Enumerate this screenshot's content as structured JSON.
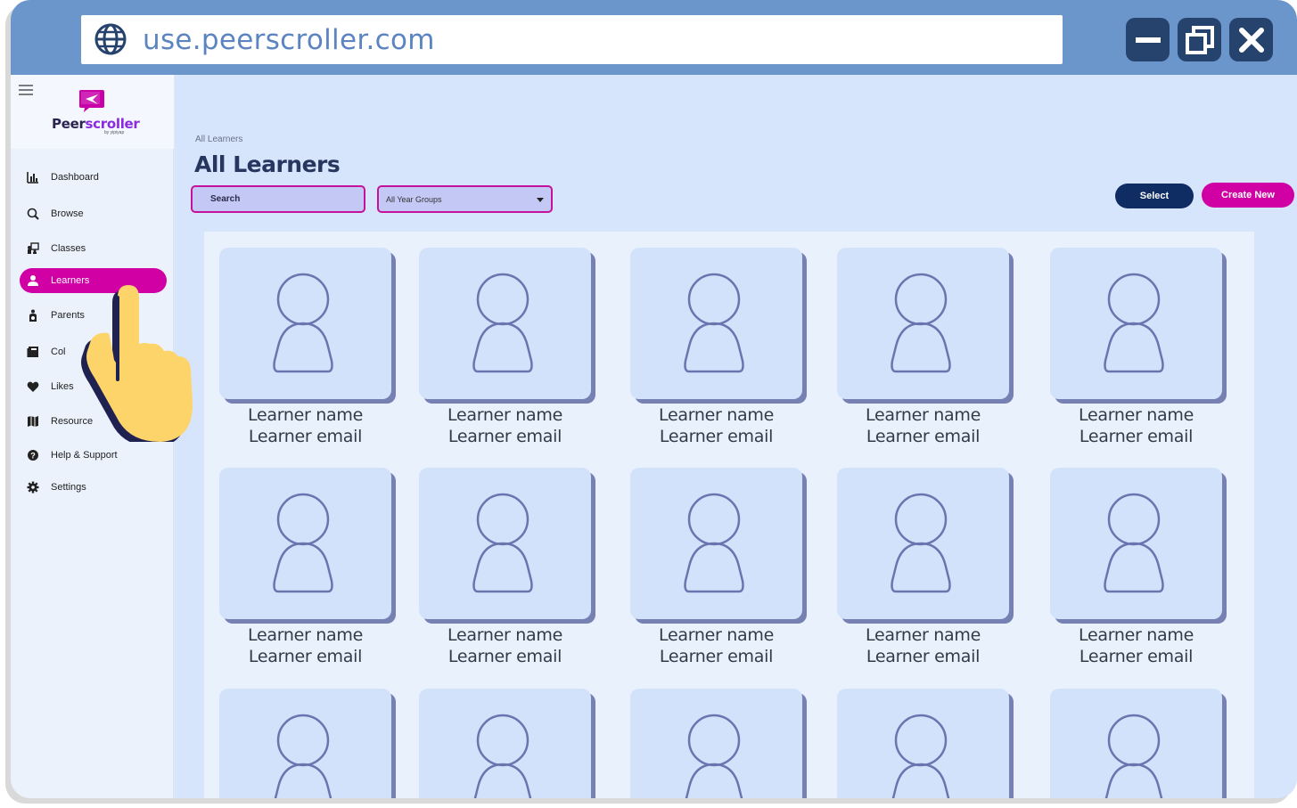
{
  "browser": {
    "url": "use.peerscroller.com"
  },
  "sidebar": {
    "brand_prefix": "Peer",
    "brand_suffix": "scroller",
    "brand_sub": "by yipiyap",
    "items": [
      {
        "label": "Dashboard",
        "icon": "bar-chart-icon",
        "active": false
      },
      {
        "label": "Browse",
        "icon": "search-icon",
        "active": false
      },
      {
        "label": "Classes",
        "icon": "classroom-icon",
        "active": false
      },
      {
        "label": "Learners",
        "icon": "person-icon",
        "active": true
      },
      {
        "label": "Parents",
        "icon": "parent-icon",
        "active": false
      },
      {
        "label": "Col",
        "icon": "book-icon",
        "active": false
      },
      {
        "label": "Likes",
        "icon": "heart-icon",
        "active": false
      },
      {
        "label": "Resource",
        "icon": "map-icon",
        "active": false
      },
      {
        "label": "Help & Support",
        "icon": "help-icon",
        "active": false
      },
      {
        "label": "Settings",
        "icon": "gear-icon",
        "active": false
      }
    ]
  },
  "main": {
    "breadcrumb": "All Learners",
    "title": "All Learners",
    "search_label": "Search",
    "filter_selected": "All Year Groups",
    "select_button": "Select",
    "create_button": "Create New",
    "learners": [
      {
        "name": "Learner name",
        "email": "Learner email"
      },
      {
        "name": "Learner name",
        "email": "Learner email"
      },
      {
        "name": "Learner name",
        "email": "Learner email"
      },
      {
        "name": "Learner name",
        "email": "Learner email"
      },
      {
        "name": "Learner name",
        "email": "Learner email"
      },
      {
        "name": "Learner name",
        "email": "Learner email"
      },
      {
        "name": "Learner name",
        "email": "Learner email"
      },
      {
        "name": "Learner name",
        "email": "Learner email"
      },
      {
        "name": "Learner name",
        "email": "Learner email"
      },
      {
        "name": "Learner name",
        "email": "Learner email"
      },
      {
        "name": "",
        "email": ""
      },
      {
        "name": "",
        "email": ""
      },
      {
        "name": "",
        "email": ""
      },
      {
        "name": "",
        "email": ""
      },
      {
        "name": "",
        "email": ""
      }
    ]
  },
  "colors": {
    "accent": "#d100a5",
    "primary_dark": "#0f2d63",
    "titlebar": "#6b96cc"
  }
}
